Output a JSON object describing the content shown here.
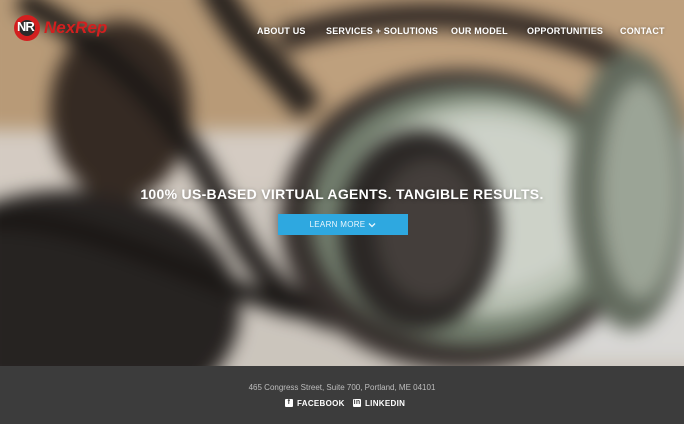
{
  "header": {
    "logo_letters": "NR",
    "logo_text": "NexRep",
    "nav": [
      {
        "label": "ABOUT US"
      },
      {
        "label": "SERVICES + SOLUTIONS"
      },
      {
        "label": "OUR MODEL"
      },
      {
        "label": "OPPORTUNITIES"
      },
      {
        "label": "CONTACT"
      }
    ]
  },
  "hero": {
    "headline": "100% US-BASED VIRTUAL AGENTS. TANGIBLE RESULTS.",
    "cta_label": "LEARN MORE",
    "cta_icon": "chevron-down-icon"
  },
  "footer": {
    "address": "465 Congress Street, Suite 700, Portland, ME 04101",
    "social": [
      {
        "label": "FACEBOOK",
        "icon": "facebook-icon",
        "glyph": "f"
      },
      {
        "label": "LINKEDIN",
        "icon": "linkedin-icon",
        "glyph": "in"
      }
    ]
  },
  "colors": {
    "brand_red": "#d31f1f",
    "cta_blue": "#2ea8e0",
    "footer_bg": "#3c3c3c"
  }
}
